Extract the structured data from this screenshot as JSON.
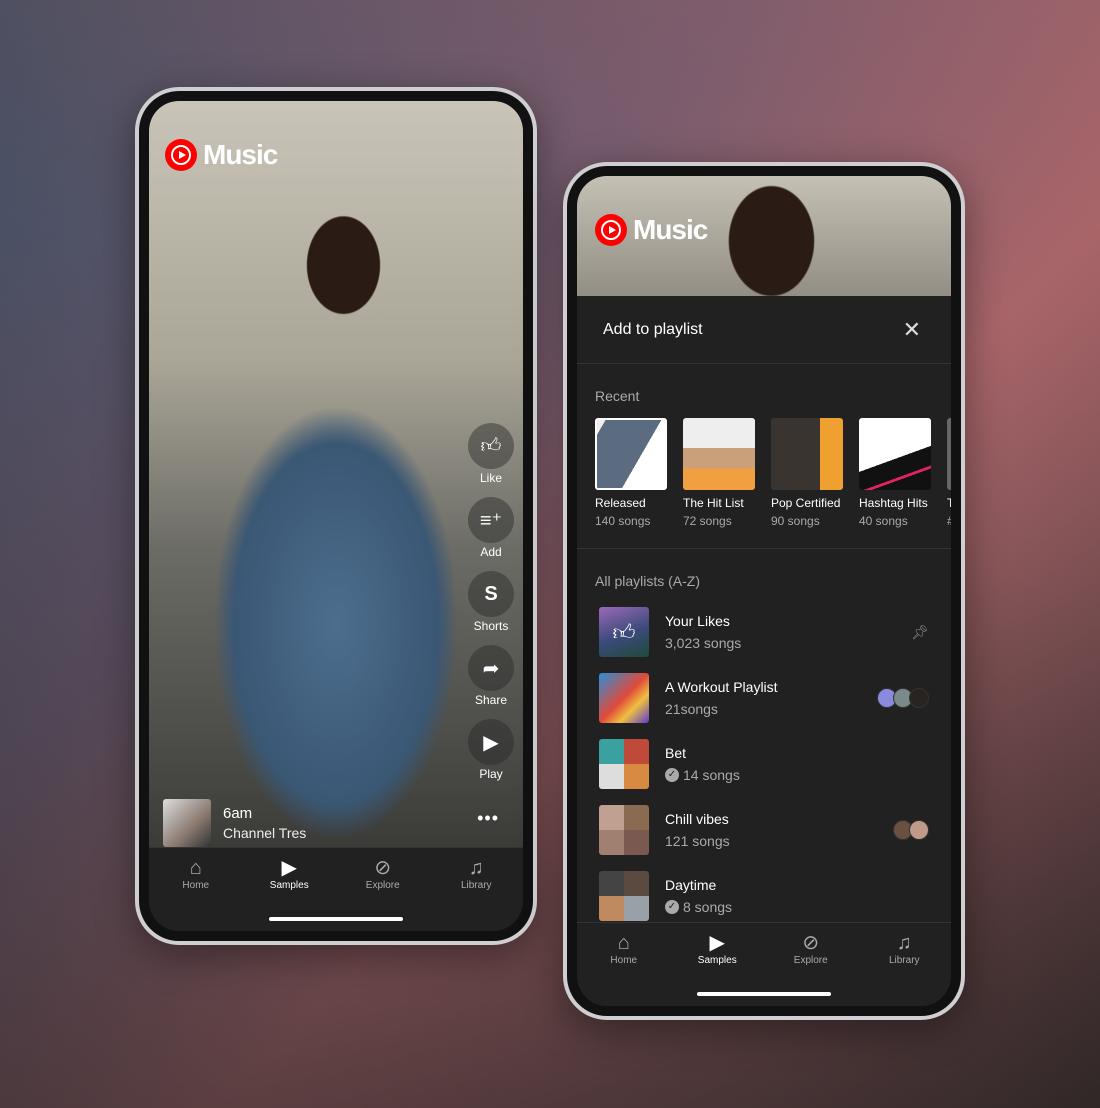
{
  "brand": {
    "logo_text": "Music",
    "accent": "#ff0000"
  },
  "left_phone": {
    "actions": [
      {
        "icon": "thumbs-up",
        "label": "Like"
      },
      {
        "icon": "playlist-add",
        "label": "Add"
      },
      {
        "icon": "shorts",
        "label": "Shorts"
      },
      {
        "icon": "share",
        "label": "Share"
      },
      {
        "icon": "play",
        "label": "Play"
      }
    ],
    "now_playing": {
      "title": "6am",
      "artist": "Channel Tres"
    },
    "more_icon": "•••"
  },
  "nav": [
    {
      "icon": "home",
      "label": "Home"
    },
    {
      "icon": "samples-play",
      "label": "Samples",
      "active": true
    },
    {
      "icon": "compass",
      "label": "Explore"
    },
    {
      "icon": "library",
      "label": "Library"
    }
  ],
  "sheet": {
    "title": "Add to playlist",
    "close": "✕",
    "recent_label": "Recent",
    "recent": [
      {
        "name": "Released",
        "count": "140 songs"
      },
      {
        "name": "The Hit List",
        "count": "72 songs"
      },
      {
        "name": "Pop Certified",
        "count": "90 songs"
      },
      {
        "name": "Hashtag Hits",
        "count": "40 songs"
      },
      {
        "name": "T",
        "count": "#"
      }
    ],
    "all_label": "All playlists (A-Z)",
    "playlists": [
      {
        "name": "Your Likes",
        "count": "3,023 songs",
        "pinned": true
      },
      {
        "name": "A Workout Playlist",
        "count": "21songs",
        "collaborators": 3
      },
      {
        "name": "Bet",
        "count": "14 songs",
        "downloaded": true
      },
      {
        "name": "Chill vibes",
        "count": "121 songs",
        "collaborators": 2
      },
      {
        "name": "Daytime",
        "count": "8 songs",
        "downloaded": true
      }
    ]
  }
}
